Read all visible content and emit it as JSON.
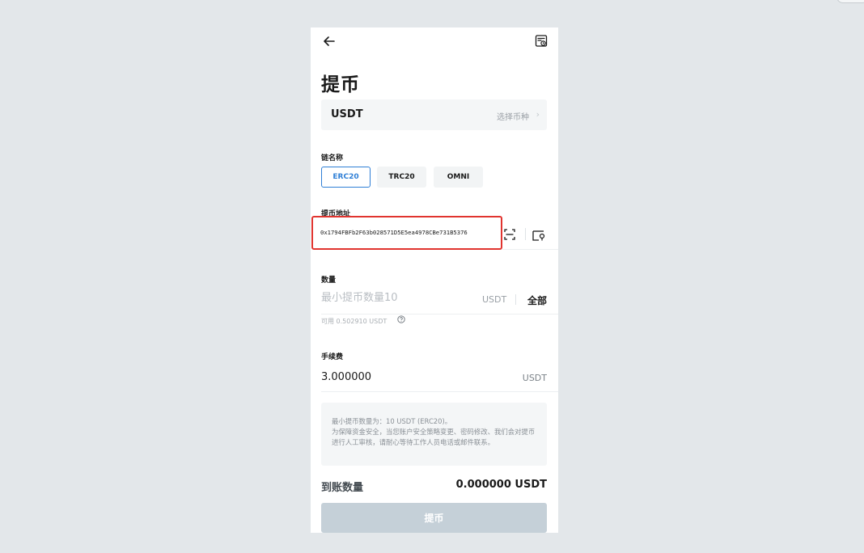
{
  "page": {
    "title": "提币"
  },
  "coin": {
    "name": "USDT",
    "select_hint": "选择币种",
    "chevron": "›"
  },
  "chain": {
    "label": "链名称",
    "options": [
      {
        "label": "ERC20",
        "active": true
      },
      {
        "label": "TRC20",
        "active": false
      },
      {
        "label": "OMNI",
        "active": false
      }
    ]
  },
  "address": {
    "label": "提币地址",
    "value": "0x1794FBFb2F63b028571D5E5ea4978CBe731B5376"
  },
  "amount": {
    "label": "数量",
    "placeholder": "最小提币数量10",
    "unit": "USDT",
    "all_label": "全部",
    "available": "可用 0.502910 USDT"
  },
  "fee": {
    "label": "手续费",
    "value": "3.000000",
    "unit": "USDT"
  },
  "notice": {
    "lines": [
      "最小提币数量为：10 USDT (ERC20)。",
      "为保障资金安全，当您账户安全策略变更、密码修改、我们会对提币进行人工审核，请耐心等待工作人员电话或邮件联系。"
    ]
  },
  "receive": {
    "label": "到账数量",
    "value": "0.000000 USDT"
  },
  "submit": {
    "label": "提币"
  },
  "colors": {
    "accent": "#2f7fd6",
    "highlight_border": "#e1342f",
    "button_disabled": "#c5d0d8",
    "background": "#e3e7ea"
  },
  "icons": {
    "back": "arrow-left-icon",
    "record": "withdraw-record-icon",
    "scan": "scan-icon",
    "address_book": "address-book-icon",
    "help": "question-circle-icon"
  }
}
